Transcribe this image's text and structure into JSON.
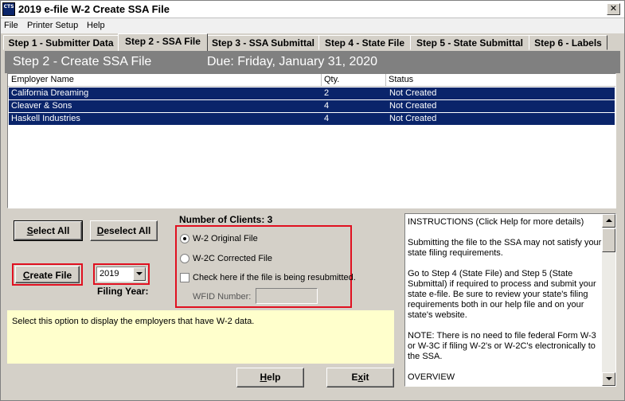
{
  "window": {
    "title": "2019 e-file W-2 Create SSA File",
    "icon_text": "CTS",
    "close_glyph": "✕"
  },
  "menu": [
    "File",
    "Printer Setup",
    "Help"
  ],
  "tabs": [
    {
      "label": "Step 1 - Submitter Data",
      "active": false
    },
    {
      "label": "Step 2 - SSA File",
      "active": true
    },
    {
      "label": "Step 3 - SSA Submittal",
      "active": false
    },
    {
      "label": "Step 4 - State File",
      "active": false
    },
    {
      "label": "Step 5 - State Submittal",
      "active": false
    },
    {
      "label": "Step 6 - Labels",
      "active": false
    }
  ],
  "header": {
    "step_title": "Step 2 - Create SSA File",
    "due": "Due: Friday, January 31, 2020"
  },
  "table": {
    "columns": [
      "Employer Name",
      "Qty.",
      "Status"
    ],
    "rows": [
      {
        "employer": "California Dreaming",
        "qty": "2",
        "status": "Not Created"
      },
      {
        "employer": "Cleaver & Sons",
        "qty": "4",
        "status": "Not Created"
      },
      {
        "employer": "Haskell Industries",
        "qty": "4",
        "status": "Not Created"
      }
    ]
  },
  "buttons": {
    "select_all_accel": "S",
    "select_all_rest": "elect All",
    "deselect_all_accel": "D",
    "deselect_all_rest": "eselect All",
    "create_file_accel": "C",
    "create_file_rest": "reate File",
    "help_accel": "H",
    "help_rest": "elp",
    "exit_pre": "E",
    "exit_accel": "x",
    "exit_rest": "it"
  },
  "clients": {
    "label": "Number of Clients: 3"
  },
  "filing_year": {
    "value": "2019",
    "label": "Filing Year:"
  },
  "file_options": {
    "original": {
      "label": "W-2 Original File",
      "selected": true
    },
    "corrected": {
      "label": "W-2C Corrected File",
      "selected": false
    },
    "resubmitted": {
      "label": "Check here if the file is being resubmitted.",
      "checked": false
    },
    "wfid_label": "WFID Number:",
    "wfid_value": ""
  },
  "hint": {
    "text": "Select this option to display the employers that have W-2 data."
  },
  "instructions": {
    "paragraphs": [
      "INSTRUCTIONS (Click Help for more details)",
      "Submitting the file to the SSA may not satisfy your state filing requirements.",
      "Go to Step 4 (State File) and Step 5 (State Submittal) if required to process and submit your state e-file. Be sure to review your state's filing requirements both in our help file and on your state's website.",
      "NOTE: There is no need to file federal Form W-3 or W-3C if filing W-2's or W-2C's electronically to the SSA.",
      "OVERVIEW"
    ]
  },
  "colors": {
    "selection": "#0a246a",
    "highlight_border": "#e01020",
    "hint_background": "#ffffcc",
    "header_band": "#808080",
    "face": "#d4d0c8"
  }
}
